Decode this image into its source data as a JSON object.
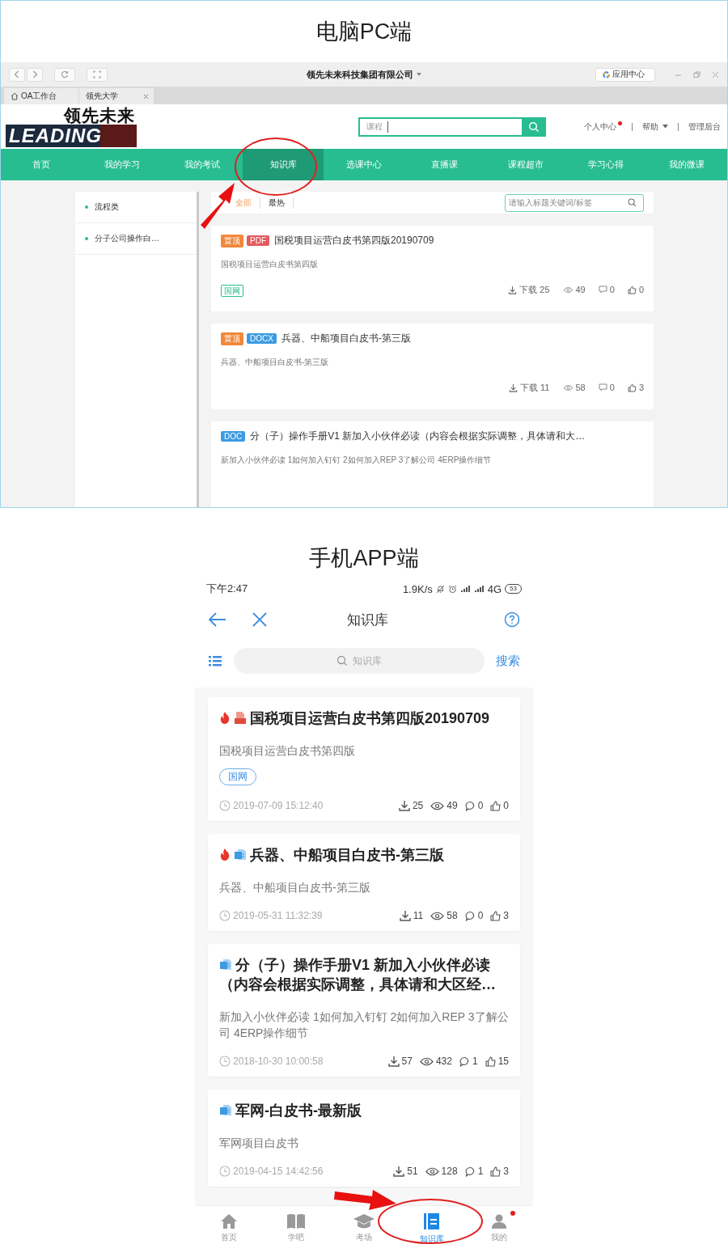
{
  "pc": {
    "heading": "电脑PC端",
    "browser": {
      "title": "领先未来科技集团有限公司",
      "app_center": "应用中心",
      "tabs": [
        {
          "label": "OA工作台",
          "kind": "home"
        },
        {
          "label": "领先大学",
          "kind": "closable"
        }
      ]
    },
    "header": {
      "logo_cn": "领先未来",
      "logo_en": "LEADING",
      "search_label": "课程",
      "links": [
        {
          "label": "个人中心",
          "badge": true,
          "caret": false
        },
        {
          "label": "帮助",
          "badge": false,
          "caret": true
        },
        {
          "label": "管理后台",
          "badge": false,
          "caret": false
        }
      ]
    },
    "nav": [
      {
        "label": "首页",
        "selected": false
      },
      {
        "label": "我的学习",
        "selected": false
      },
      {
        "label": "我的考试",
        "selected": false
      },
      {
        "label": "知识库",
        "selected": true
      },
      {
        "label": "选课中心",
        "selected": false
      },
      {
        "label": "直播课",
        "selected": false
      },
      {
        "label": "课程超市",
        "selected": false
      },
      {
        "label": "学习心得",
        "selected": false
      },
      {
        "label": "我的微课",
        "selected": false
      }
    ],
    "sidebar": [
      "流程类",
      "分子公司操作白…"
    ],
    "filters": [
      {
        "label": "全部",
        "selected": true
      },
      {
        "label": "最热",
        "selected": false
      }
    ],
    "search_placeholder": "请输入标题关键词/标签",
    "docs": [
      {
        "badges": [
          {
            "label": "置顶",
            "color": "#f0883c"
          },
          {
            "label": "PDF",
            "color": "#e25b5f"
          }
        ],
        "title": "国税项目运营白皮书第四版20190709",
        "summary": "国税项目运营白皮书第四版",
        "category": "国网",
        "stats": [
          "下载 25",
          "49",
          "0",
          "0"
        ]
      },
      {
        "badges": [
          {
            "label": "置顶",
            "color": "#f0883c"
          },
          {
            "label": "DOCX",
            "color": "#3d9be0"
          }
        ],
        "title": "兵器、中船项目白皮书-第三版",
        "summary": "兵器、中船项目白皮书-第三版",
        "stats": [
          "下载 11",
          "58",
          "0",
          "3"
        ]
      },
      {
        "badges": [
          {
            "label": "DOC",
            "color": "#3d9be0"
          }
        ],
        "title": "分（子）操作手册V1 新加入小伙伴必读（内容会根据实际调整，具体请和大…",
        "summary": "新加入小伙伴必读 1如何加入钉钉 2如何加入REP 3了解公司 4ERP操作细节"
      }
    ]
  },
  "mobile": {
    "heading": "手机APP端",
    "status": {
      "time": "下午2:47",
      "speed": "1.9K/s",
      "network": "4G",
      "battery": "53"
    },
    "title": "知识库",
    "search_placeholder": "知识库",
    "search_button": "搜索",
    "docs": [
      {
        "hot": true,
        "kind": "pdf",
        "title": "国税项目运营白皮书第四版20190709",
        "summary": "国税项目运营白皮书第四版",
        "category": "国网",
        "time": "2019-07-09 15:12:40",
        "stats": [
          "25",
          "49",
          "0",
          "0"
        ]
      },
      {
        "hot": true,
        "kind": "word",
        "title": "兵器、中船项目白皮书-第三版",
        "summary": "兵器、中船项目白皮书-第三版",
        "time": "2019-05-31 11:32:39",
        "stats": [
          "11",
          "58",
          "0",
          "3"
        ]
      },
      {
        "hot": false,
        "kind": "word",
        "title": "分（子）操作手册V1 新加入小伙伴必读（内容会根据实际调整，具体请和大区经…",
        "summary": "新加入小伙伴必读 1如何加入钉钉 2如何加入REP 3了解公司 4ERP操作细节",
        "time": "2018-10-30 10:00:58",
        "stats": [
          "57",
          "432",
          "1",
          "15"
        ]
      },
      {
        "hot": false,
        "kind": "word",
        "title": "军网-白皮书-最新版",
        "summary": "军网项目白皮书",
        "time": "2019-04-15 14:42:56",
        "stats": [
          "51",
          "128",
          "1",
          "3"
        ]
      }
    ],
    "tabs": [
      {
        "label": "首页",
        "kind": "home",
        "selected": false,
        "badge": false
      },
      {
        "label": "学吧",
        "kind": "book",
        "selected": false,
        "badge": false
      },
      {
        "label": "考场",
        "kind": "cap",
        "selected": false,
        "badge": false
      },
      {
        "label": "知识库",
        "kind": "library",
        "selected": true,
        "badge": false
      },
      {
        "label": "我的",
        "kind": "person",
        "selected": false,
        "badge": true
      }
    ]
  }
}
